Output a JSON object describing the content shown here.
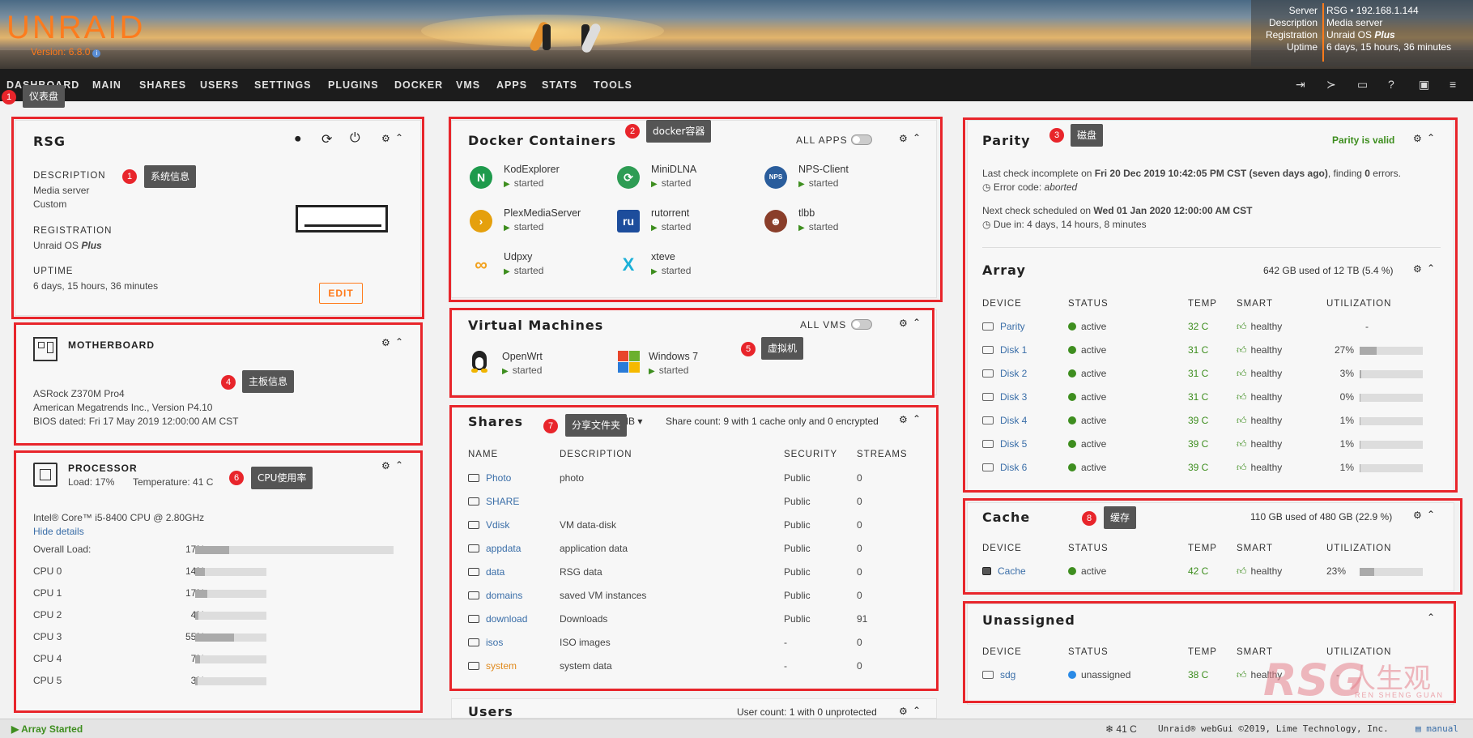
{
  "header": {
    "logo": "UNRAID",
    "version": "Version: 6.8.0",
    "server": {
      "labels": [
        "Server",
        "Description",
        "Registration",
        "Uptime"
      ],
      "values": [
        "RSG • 192.168.1.144",
        "Media server",
        "Unraid OS Plus",
        "6 days, 15 hours, 36 minutes"
      ]
    }
  },
  "nav": {
    "items": [
      "DASHBOARD",
      "MAIN",
      "SHARES",
      "USERS",
      "SETTINGS",
      "PLUGINS",
      "DOCKER",
      "VMS",
      "APPS",
      "STATS",
      "TOOLS"
    ],
    "icons": [
      "logout-icon",
      "terminal-icon",
      "feedback-icon",
      "help-icon",
      "info-icon",
      "log-icon"
    ]
  },
  "callouts": [
    {
      "num": "1",
      "text": "仪表盘"
    },
    {
      "num": "1",
      "text": "系统信息"
    },
    {
      "num": "2",
      "text": "docker容器"
    },
    {
      "num": "3",
      "text": "磁盘"
    },
    {
      "num": "4",
      "text": "主板信息"
    },
    {
      "num": "5",
      "text": "虚拟机"
    },
    {
      "num": "6",
      "text": "CPU使用率"
    },
    {
      "num": "7",
      "text": "分享文件夹"
    },
    {
      "num": "8",
      "text": "缓存"
    }
  ],
  "system": {
    "title": "RSG",
    "description_label": "DESCRIPTION",
    "description_lines": [
      "Media server",
      "Custom"
    ],
    "registration_label": "REGISTRATION",
    "registration_value": "Unraid OS",
    "registration_plus": "Plus",
    "uptime_label": "UPTIME",
    "uptime_value": "6 days, 15 hours, 36 minutes",
    "edit_label": "EDIT"
  },
  "motherboard": {
    "title": "MOTHERBOARD",
    "lines": [
      "ASRock Z370M Pro4",
      "American Megatrends Inc., Version P4.10",
      "BIOS dated: Fri 17 May 2019 12:00:00 AM CST"
    ]
  },
  "processor": {
    "title": "PROCESSOR",
    "load": "Load: 17%",
    "temperature": "Temperature: 41 C",
    "model": "Intel® Core™ i5-8400 CPU @ 2.80GHz",
    "hide_details": "Hide details",
    "rows": [
      {
        "label": "Overall Load:",
        "value": "17%",
        "pct": 17
      },
      {
        "label": "CPU 0",
        "value": "14%",
        "pct": 14
      },
      {
        "label": "CPU 1",
        "value": "17%",
        "pct": 17
      },
      {
        "label": "CPU 2",
        "value": "4%",
        "pct": 4
      },
      {
        "label": "CPU 3",
        "value": "55%",
        "pct": 55
      },
      {
        "label": "CPU 4",
        "value": "7%",
        "pct": 7
      },
      {
        "label": "CPU 5",
        "value": "3%",
        "pct": 3
      }
    ]
  },
  "docker": {
    "title": "Docker Containers",
    "all_apps": "ALL APPS",
    "apps": [
      {
        "name": "KodExplorer",
        "status": "started",
        "color": "#1e9a4c"
      },
      {
        "name": "MiniDLNA",
        "status": "started",
        "color": "#2e9c54"
      },
      {
        "name": "NPS-Client",
        "status": "started",
        "color": "#2a5d9c"
      },
      {
        "name": "PlexMediaServer",
        "status": "started",
        "color": "#e5a00d"
      },
      {
        "name": "rutorrent",
        "status": "started",
        "color": "#1d4d9c"
      },
      {
        "name": "tlbb",
        "status": "started",
        "color": "#8a3e2a"
      },
      {
        "name": "Udpxy",
        "status": "started",
        "color": "#f2a21e"
      },
      {
        "name": "xteve",
        "status": "started",
        "color": "#1bb0d8"
      }
    ]
  },
  "vms": {
    "title": "Virtual Machines",
    "all_vms": "ALL VMS",
    "items": [
      {
        "name": "OpenWrt",
        "status": "started"
      },
      {
        "name": "Windows 7",
        "status": "started"
      }
    ]
  },
  "shares": {
    "title": "Shares",
    "smb": "SMB",
    "count_text": "Share count: 9 with 1 cache only and 0 encrypted",
    "headers": [
      "NAME",
      "DESCRIPTION",
      "SECURITY",
      "STREAMS"
    ],
    "rows": [
      {
        "name": "Photo",
        "desc": "photo",
        "sec": "Public",
        "streams": "0",
        "color": "#3a6ea8"
      },
      {
        "name": "SHARE",
        "desc": "",
        "sec": "Public",
        "streams": "0",
        "color": "#3a6ea8"
      },
      {
        "name": "Vdisk",
        "desc": "VM data-disk",
        "sec": "Public",
        "streams": "0",
        "color": "#3a6ea8"
      },
      {
        "name": "appdata",
        "desc": "application data",
        "sec": "Public",
        "streams": "0",
        "color": "#3a6ea8"
      },
      {
        "name": "data",
        "desc": "RSG data",
        "sec": "Public",
        "streams": "0",
        "color": "#3a6ea8"
      },
      {
        "name": "domains",
        "desc": "saved VM instances",
        "sec": "Public",
        "streams": "0",
        "color": "#3a6ea8"
      },
      {
        "name": "download",
        "desc": "Downloads",
        "sec": "Public",
        "streams": "91",
        "color": "#3a6ea8"
      },
      {
        "name": "isos",
        "desc": "ISO images",
        "sec": "-",
        "streams": "0",
        "color": "#3a6ea8"
      },
      {
        "name": "system",
        "desc": "system data",
        "sec": "-",
        "streams": "0",
        "color": "#e08a1e"
      }
    ]
  },
  "users": {
    "title": "Users",
    "count_text": "User count: 1 with 0 unprotected"
  },
  "parity": {
    "title": "Parity",
    "status": "Parity is valid",
    "line1_pre": "Last check incomplete on ",
    "line1_date": "Fri 20 Dec 2019 10:42:05 PM CST (seven days ago)",
    "line1_mid": ", finding ",
    "line1_errors": "0",
    "line1_post": " errors.",
    "line2_pre": "Error code: ",
    "line2_code": "aborted",
    "line3_pre": "Next check scheduled on ",
    "line3_date": "Wed 01 Jan 2020 12:00:00 AM CST",
    "line4": "Due in: 4 days, 14 hours, 8 minutes"
  },
  "array": {
    "title": "Array",
    "usage": "642 GB used of 12 TB (5.4 %)",
    "headers": [
      "DEVICE",
      "STATUS",
      "TEMP",
      "SMART",
      "UTILIZATION"
    ],
    "rows": [
      {
        "device": "Parity",
        "status": "active",
        "temp": "32 C",
        "smart": "healthy",
        "util": "-",
        "pct": null
      },
      {
        "device": "Disk 1",
        "status": "active",
        "temp": "31 C",
        "smart": "healthy",
        "util": "27%",
        "pct": 27
      },
      {
        "device": "Disk 2",
        "status": "active",
        "temp": "31 C",
        "smart": "healthy",
        "util": "3%",
        "pct": 3
      },
      {
        "device": "Disk 3",
        "status": "active",
        "temp": "31 C",
        "smart": "healthy",
        "util": "0%",
        "pct": 0
      },
      {
        "device": "Disk 4",
        "status": "active",
        "temp": "39 C",
        "smart": "healthy",
        "util": "1%",
        "pct": 1
      },
      {
        "device": "Disk 5",
        "status": "active",
        "temp": "39 C",
        "smart": "healthy",
        "util": "1%",
        "pct": 1
      },
      {
        "device": "Disk 6",
        "status": "active",
        "temp": "39 C",
        "smart": "healthy",
        "util": "1%",
        "pct": 1
      }
    ]
  },
  "cache": {
    "title": "Cache",
    "usage": "110 GB used of 480 GB (22.9 %)",
    "headers": [
      "DEVICE",
      "STATUS",
      "TEMP",
      "SMART",
      "UTILIZATION"
    ],
    "row": {
      "device": "Cache",
      "status": "active",
      "temp": "42 C",
      "smart": "healthy",
      "util": "23%",
      "pct": 23
    }
  },
  "unassigned": {
    "title": "Unassigned",
    "headers": [
      "DEVICE",
      "STATUS",
      "TEMP",
      "SMART",
      "UTILIZATION"
    ],
    "row": {
      "device": "sdg",
      "status": "unassigned",
      "temp": "38 C",
      "smart": "healthy",
      "util": "-"
    }
  },
  "footer": {
    "array_status": "Array Started",
    "temp": "41 C",
    "copyright": "Unraid® webGui ©2019, Lime Technology, Inc.",
    "manual": "manual"
  },
  "watermark": {
    "main": "RSG",
    "cn": "人生观",
    "sub": "REN SHENG GUAN"
  },
  "colors": {
    "accent": "#ff7a1a",
    "callout_red": "#e8252b",
    "active_green": "#3e8e1f",
    "link_blue": "#3a6ea8",
    "unassigned_blue": "#2a8ae6"
  }
}
